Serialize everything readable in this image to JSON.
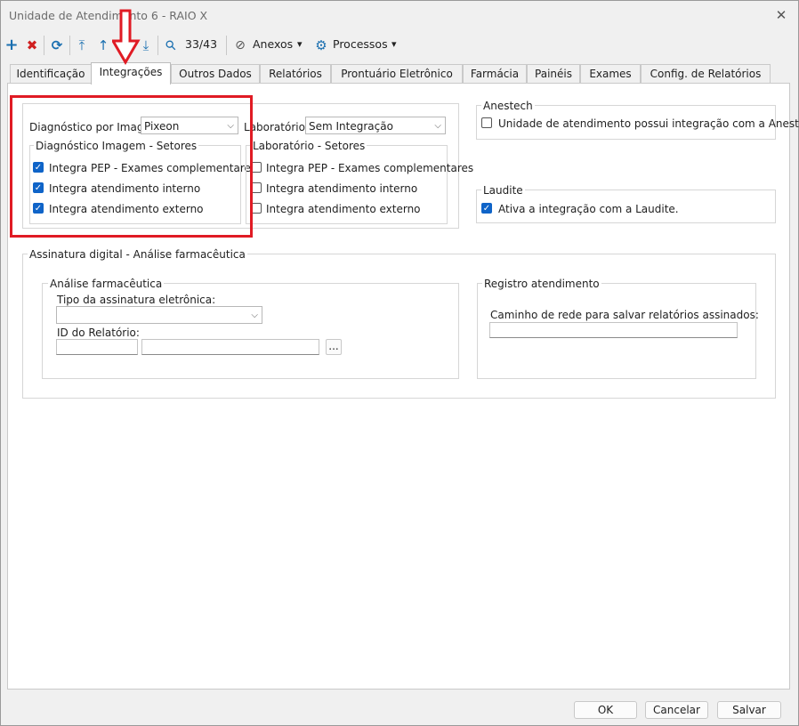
{
  "window": {
    "title": "Unidade de Atendimento 6 - RAIO X",
    "close_glyph": "✕"
  },
  "toolbar": {
    "add_icon": "+",
    "delete_icon": "✖",
    "refresh_icon": "⟳",
    "first_icon": "⤒",
    "prev_icon": "↑",
    "next_icon": "↓",
    "last_icon": "⤓",
    "search_icon": "⚲",
    "record_counter": "33/43",
    "attachments_label": "Anexos",
    "processes_label": "Processos",
    "dropdown_glyph": "▾"
  },
  "tabs": [
    {
      "label": "Identificação"
    },
    {
      "label": "Integrações"
    },
    {
      "label": "Outros Dados"
    },
    {
      "label": "Relatórios"
    },
    {
      "label": "Prontuário Eletrônico"
    },
    {
      "label": "Farmácia"
    },
    {
      "label": "Painéis"
    },
    {
      "label": "Exames"
    },
    {
      "label": "Config. de Relatórios"
    }
  ],
  "imaging": {
    "label": "Diagnóstico por Imagem:",
    "value": "Pixeon",
    "sectors_title": "Diagnóstico Imagem - Setores",
    "options": [
      {
        "label": "Integra PEP - Exames complementares",
        "checked": true
      },
      {
        "label": "Integra atendimento interno",
        "checked": true
      },
      {
        "label": "Integra atendimento externo",
        "checked": true
      }
    ]
  },
  "laboratory": {
    "label": "Laboratório:",
    "value": "Sem Integração",
    "sectors_title": "Laboratório - Setores",
    "options": [
      {
        "label": "Integra PEP - Exames complementares",
        "checked": false
      },
      {
        "label": "Integra atendimento interno",
        "checked": false
      },
      {
        "label": "Integra atendimento externo",
        "checked": false
      }
    ]
  },
  "anestech": {
    "title": "Anestech",
    "option": "Unidade de atendimento possui integração com a Anestech",
    "checked": false
  },
  "laudite": {
    "title": "Laudite",
    "option": "Ativa a integração com a Laudite.",
    "checked": true
  },
  "signature": {
    "title": "Assinatura digital - Análise farmacêutica",
    "pharma": {
      "title": "Análise farmacêutica",
      "type_label": "Tipo da assinatura eletrônica:",
      "type_value": "",
      "report_id_label": "ID do Relatório:",
      "report_id_value": "",
      "report_name_value": "",
      "browse_label": "..."
    },
    "registry": {
      "title": "Registro atendimento",
      "path_label": "Caminho de rede para salvar relatórios assinados:",
      "path_value": ""
    }
  },
  "footer": {
    "ok_label": "OK",
    "cancel_label": "Cancelar",
    "save_label": "Salvar"
  },
  "colors": {
    "accent": "#0f64c8",
    "highlight": "#e01b24",
    "toolbar_icon": "#1a6fb0"
  }
}
